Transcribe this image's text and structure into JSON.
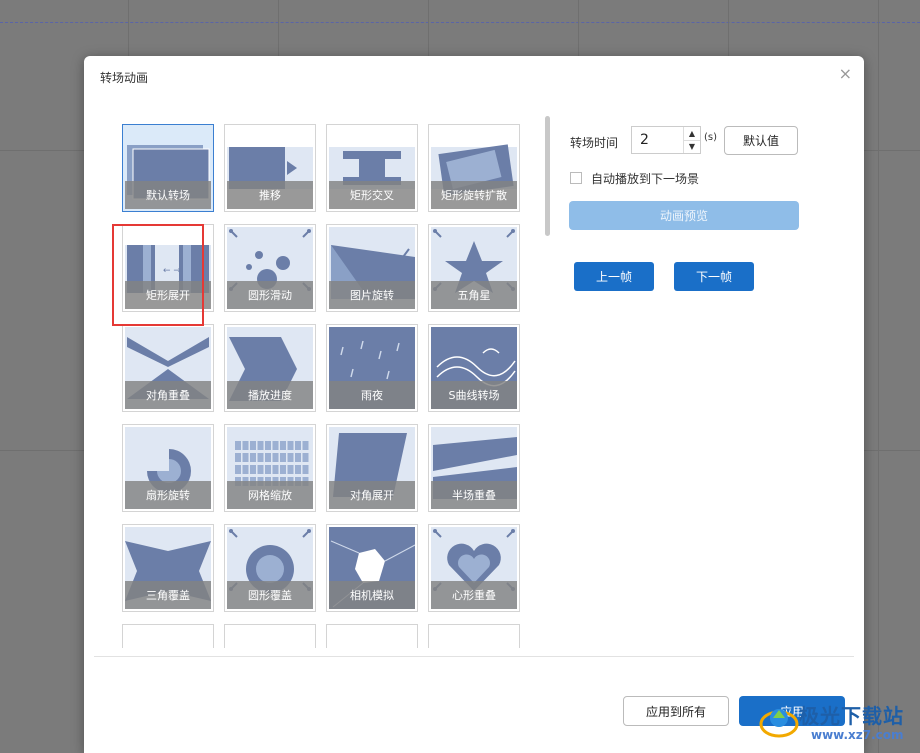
{
  "dialog": {
    "title": "转场动画",
    "close": "×"
  },
  "transitions": [
    "默认转场",
    "推移",
    "矩形交叉",
    "矩形旋转扩散",
    "矩形展开",
    "圆形滑动",
    "图片旋转",
    "五角星",
    "对角重叠",
    "播放进度",
    "雨夜",
    "S曲线转场",
    "扇形旋转",
    "网格缩放",
    "对角展开",
    "半场重叠",
    "三角覆盖",
    "圆形覆盖",
    "相机模拟",
    "心形重叠"
  ],
  "selected": "默认转场",
  "highlighted": "矩形展开",
  "settings": {
    "duration_label": "转场时间",
    "duration_value": "2",
    "duration_unit": "(s)",
    "spin_up": "▲",
    "spin_down": "▼",
    "default_button": "默认值",
    "autoplay_label": "自动播放到下一场景",
    "autoplay_checked": false,
    "preview_button": "动画预览",
    "prev_frame_button": "上一帧",
    "next_frame_button": "下一帧"
  },
  "footer": {
    "apply_all_button": "应用到所有",
    "apply_button": "应用"
  },
  "watermark": {
    "text": "极光下载站",
    "url": "www.xz7.com"
  },
  "colors": {
    "primary": "#1a6fc8",
    "preview_disabled": "#8fbde8",
    "highlight_box": "#e53935",
    "thumb_fill": "#6b7ea8",
    "thumb_bg": "#dfe7f3"
  }
}
